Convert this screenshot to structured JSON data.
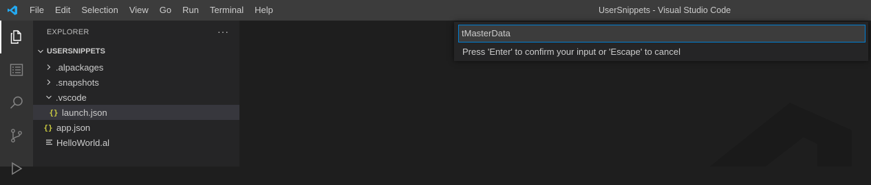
{
  "titlebar": {
    "menu": [
      "File",
      "Edit",
      "Selection",
      "View",
      "Go",
      "Run",
      "Terminal",
      "Help"
    ],
    "window_title": "UserSnippets - Visual Studio Code",
    "logo_icon": "vscode-logo-icon"
  },
  "activity_bar": {
    "icons": [
      "explorer-icon",
      "outline-icon",
      "search-icon",
      "source-control-icon",
      "run-icon"
    ],
    "active": "explorer-icon"
  },
  "sidebar": {
    "title": "EXPLORER",
    "more": "···",
    "folder": "USERSNIPPETS",
    "items": [
      {
        "label": ".alpackages",
        "type": "folder",
        "expanded": false
      },
      {
        "label": ".snapshots",
        "type": "folder",
        "expanded": false
      },
      {
        "label": ".vscode",
        "type": "folder",
        "expanded": true
      },
      {
        "label": "launch.json",
        "type": "json",
        "selected": true
      },
      {
        "label": "app.json",
        "type": "json"
      },
      {
        "label": "HelloWorld.al",
        "type": "al"
      }
    ],
    "json_icon_text": "{}"
  },
  "quick_input": {
    "value": "tMasterData",
    "message": "Press 'Enter' to confirm your input or 'Escape' to cancel"
  },
  "colors": {
    "titlebar": "#3c3c3c",
    "activitybar": "#333333",
    "sidebar": "#252526",
    "editor": "#1e1e1e",
    "focus_border": "#007fd4",
    "json_icon": "#cbcb41",
    "vscode_blue": "#23a9f2"
  }
}
